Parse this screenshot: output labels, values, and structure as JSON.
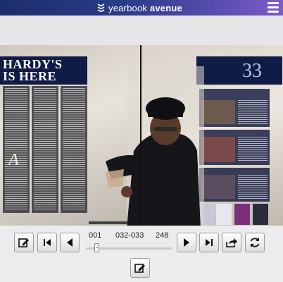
{
  "header": {
    "brand_light": "yearbook",
    "brand_bold": "avenue",
    "logo_icon": "stacked-chevrons-logo-icon",
    "menu_icon": "hamburger-menu-icon"
  },
  "spread": {
    "left_headline_line1": "HARDY'S",
    "left_headline_line2": "IS HERE",
    "right_page_number": "33",
    "left_dropcap": "A"
  },
  "controls": {
    "first_page": "001",
    "current_pages": "032-033",
    "last_page": "248",
    "slider_position_fraction": 0.13,
    "icons": {
      "edit": "edit-note-icon",
      "first": "skip-to-first-icon",
      "prev": "previous-page-icon",
      "next": "next-page-icon",
      "last": "skip-to-last-icon",
      "share": "share-icon",
      "rotate": "refresh-icon"
    }
  },
  "colors": {
    "header_gradient_start": "#1d2d6b",
    "header_gradient_end": "#7d5ac9",
    "page_block_navy": "#101c46"
  }
}
